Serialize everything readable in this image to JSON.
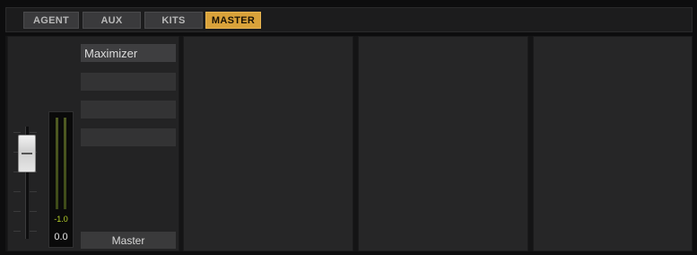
{
  "tabs": [
    {
      "label": "AGENT",
      "active": false
    },
    {
      "label": "AUX",
      "active": false
    },
    {
      "label": "KITS",
      "active": false
    },
    {
      "label": "MASTER",
      "active": true
    }
  ],
  "channel": {
    "inserts": [
      {
        "label": "Maximizer"
      },
      {
        "label": ""
      },
      {
        "label": ""
      },
      {
        "label": ""
      }
    ],
    "meter_peak": "-1.0",
    "volume": "0.0",
    "name": "Master"
  },
  "colors": {
    "active_tab": "#d9a23a",
    "meter_peak_text": "#b6d12a",
    "panel_bg": "#262627"
  }
}
